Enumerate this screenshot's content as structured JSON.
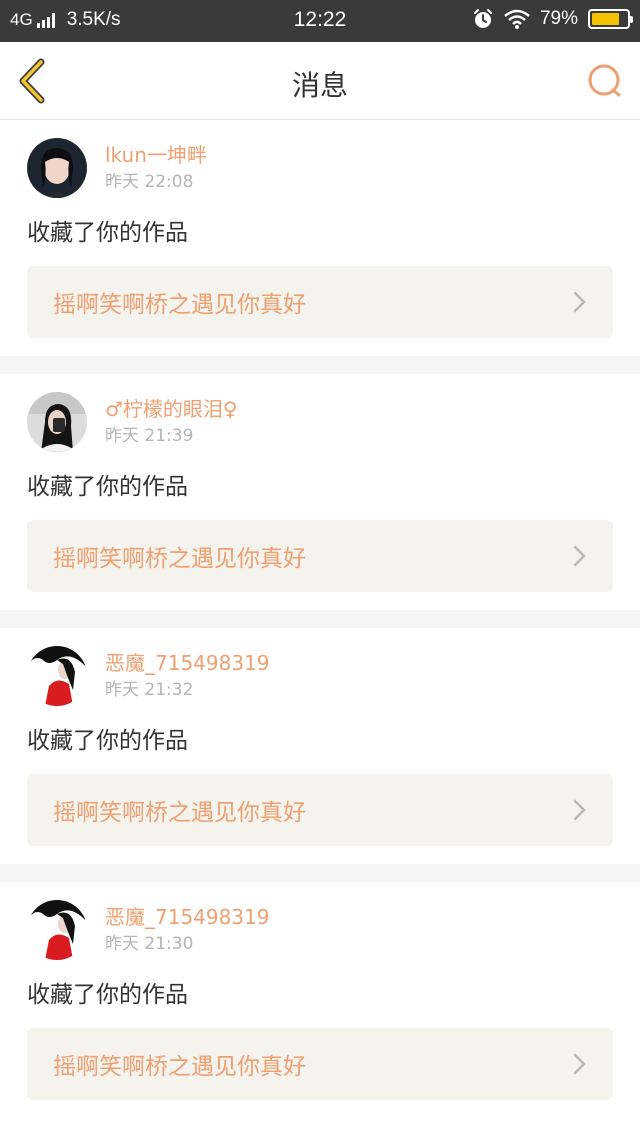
{
  "status_bar": {
    "network": "4G",
    "speed": "3.5K/s",
    "time": "12:22",
    "battery": "79%",
    "battery_level": 0.79,
    "battery_color": "#f5c200"
  },
  "nav": {
    "title": "消息",
    "back_icon": "back-chevron-icon",
    "search_icon": "search-icon",
    "accent": "#f0a070"
  },
  "messages": [
    {
      "user": "lkun一坤畔",
      "time": "昨天 22:08",
      "action": "收藏了你的作品",
      "work": "摇啊笑啊桥之遇见你真好"
    },
    {
      "user": "♂柠檬的眼泪♀",
      "time": "昨天 21:39",
      "action": "收藏了你的作品",
      "work": "摇啊笑啊桥之遇见你真好"
    },
    {
      "user": "恶魔_715498319",
      "time": "昨天 21:32",
      "action": "收藏了你的作品",
      "work": "摇啊笑啊桥之遇见你真好"
    },
    {
      "user": "恶魔_715498319",
      "time": "昨天 21:30",
      "action": "收藏了你的作品",
      "work": "摇啊笑啊桥之遇见你真好"
    }
  ]
}
